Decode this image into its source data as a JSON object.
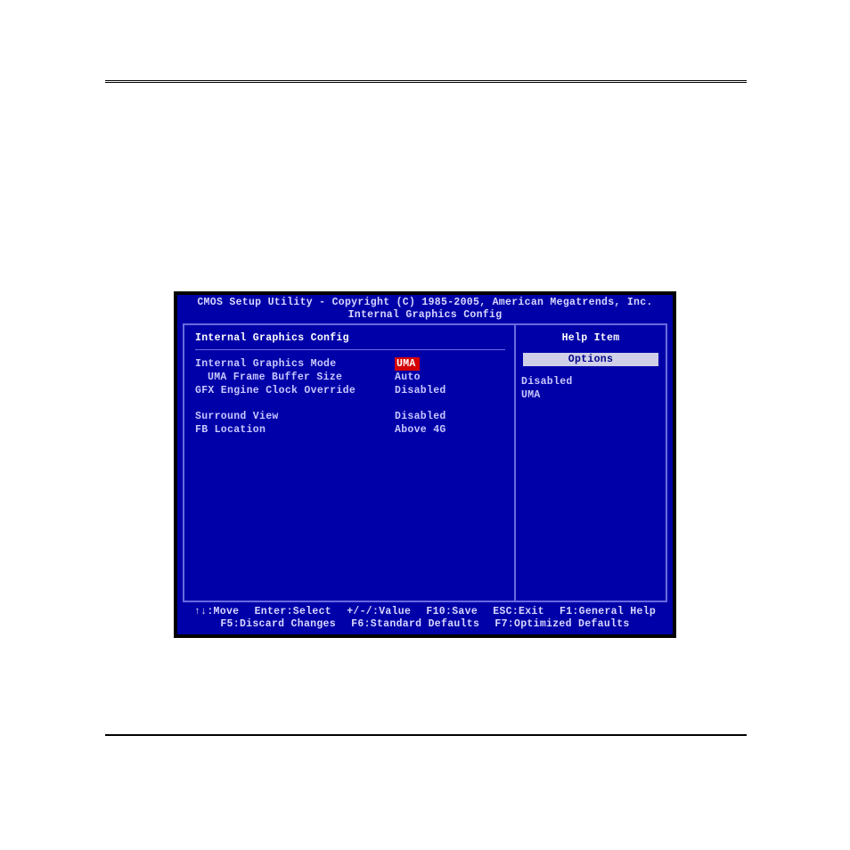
{
  "header": {
    "line1": "CMOS Setup Utility - Copyright (C) 1985-2005, American Megatrends, Inc.",
    "line2": "Internal Graphics Config"
  },
  "left": {
    "section": "Internal Graphics Config",
    "rows": [
      {
        "label": "Internal Graphics Mode",
        "value": "UMA",
        "selected": true,
        "indent": false
      },
      {
        "label": "UMA Frame Buffer Size",
        "value": "Auto",
        "selected": false,
        "indent": true
      },
      {
        "label": "GFX Engine Clock Override",
        "value": "Disabled",
        "selected": false,
        "indent": false
      }
    ],
    "rows2": [
      {
        "label": "Surround View",
        "value": "Disabled",
        "selected": false,
        "indent": false
      },
      {
        "label": "FB Location",
        "value": "Above 4G",
        "selected": false,
        "indent": false
      }
    ]
  },
  "right": {
    "title": "Help Item",
    "banner": "Options",
    "options": [
      "Disabled",
      "UMA"
    ]
  },
  "footer": {
    "line1": [
      "↑↓:Move",
      "Enter:Select",
      "+/-/:Value",
      "F10:Save",
      "ESC:Exit",
      "F1:General Help"
    ],
    "line2": [
      "F5:Discard Changes",
      "F6:Standard Defaults",
      "F7:Optimized Defaults"
    ]
  }
}
